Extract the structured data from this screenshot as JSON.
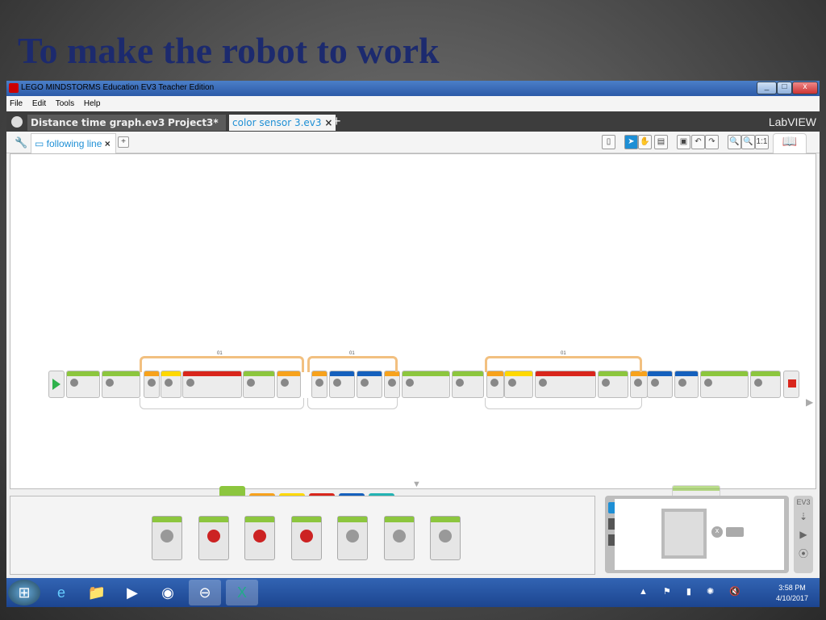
{
  "slide_title": "To make the robot to work",
  "window": {
    "title": "LEGO MINDSTORMS Education EV3 Teacher Edition",
    "minimize": "_",
    "maximize": "□",
    "close": "x"
  },
  "menu": [
    "File",
    "Edit",
    "Tools",
    "Help"
  ],
  "project_tabs": [
    {
      "label": "Distance time graph.ev3*",
      "close": "×"
    },
    {
      "label": "Project3*",
      "close": ""
    },
    {
      "label": "color sensor 3.ev3",
      "close": "×",
      "active": true
    }
  ],
  "add_tab": "+",
  "brand": "LabVIEW",
  "program_tab": {
    "label": "following line",
    "close": "×",
    "add": "+"
  },
  "toolbar": {
    "zoom_reset": "1:1"
  },
  "loops": [
    {
      "label": "01"
    },
    {
      "label": "01"
    },
    {
      "label": "01"
    }
  ],
  "block_colors": {
    "flow": "#f7a21c",
    "action": "#8cc63e",
    "sensor": "#ffd800",
    "data": "#d9261c",
    "advanced": "#1560bd",
    "myblocks": "#22b3b3",
    "start": "#2fb24c",
    "stop": "#d9261c"
  },
  "blocks": [
    "start",
    "action",
    "action",
    "flow",
    "sensor",
    "data",
    "action",
    "flow",
    "flow",
    "advanced",
    "advanced",
    "flow",
    "action",
    "action",
    "flow",
    "sensor",
    "data",
    "action",
    "flow",
    "advanced",
    "advanced",
    "action",
    "action",
    "stop"
  ],
  "palette_tabs": [
    "action",
    "flow",
    "sensor",
    "data",
    "advanced",
    "myblocks"
  ],
  "palette_count": 7,
  "hw_panel": {
    "label": "EV3"
  },
  "taskbar": {
    "time": "3:58 PM",
    "date": "4/10/2017",
    "tray": "▲ ⚑ ▮ ✺ 🔇"
  }
}
